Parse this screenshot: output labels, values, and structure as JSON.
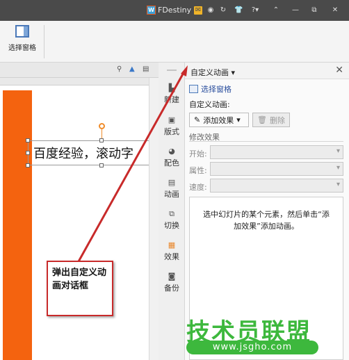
{
  "titlebar": {
    "username": "FDestiny",
    "help_label": "?",
    "icons": [
      "wps-logo-icon",
      "mail-icon",
      "shield-icon",
      "refresh-icon",
      "shirt-icon",
      "help-icon",
      "chevron-up-icon",
      "minimize-icon",
      "restore-icon",
      "close-icon"
    ],
    "bg_color": "#4a4a4a"
  },
  "ribbon": {
    "selection_pane_label": "选择窗格"
  },
  "slide": {
    "text": "百度经验，滚动字",
    "accent_color": "#f4630f"
  },
  "side_tabs": [
    {
      "label": "新建",
      "icon": "new-slide-icon"
    },
    {
      "label": "版式",
      "icon": "layout-icon"
    },
    {
      "label": "配色",
      "icon": "palette-icon"
    },
    {
      "label": "动画",
      "icon": "animation-icon"
    },
    {
      "label": "切换",
      "icon": "transition-icon"
    },
    {
      "label": "效果",
      "icon": "effect-icon"
    },
    {
      "label": "备份",
      "icon": "backup-icon"
    }
  ],
  "pane": {
    "title": "自定义动画",
    "dropdown_glyph": "▾",
    "close_glyph": "✕",
    "selection_pane_link": "选择窗格",
    "custom_animation_label": "自定义动画:",
    "add_effect_label": "添加效果",
    "delete_label": "删除",
    "modify_effect_label": "修改效果",
    "start_label": "开始:",
    "property_label": "属性:",
    "speed_label": "速度:",
    "hint": "选中幻灯片的某个元素，然后单击“添加效果”添加动画。"
  },
  "annotation": {
    "text": "弹出自定义动画对话框",
    "color": "#c82a2a"
  },
  "watermark": {
    "title": "技术员联盟",
    "url": "www.jsgho.com",
    "color": "#3db83d"
  }
}
